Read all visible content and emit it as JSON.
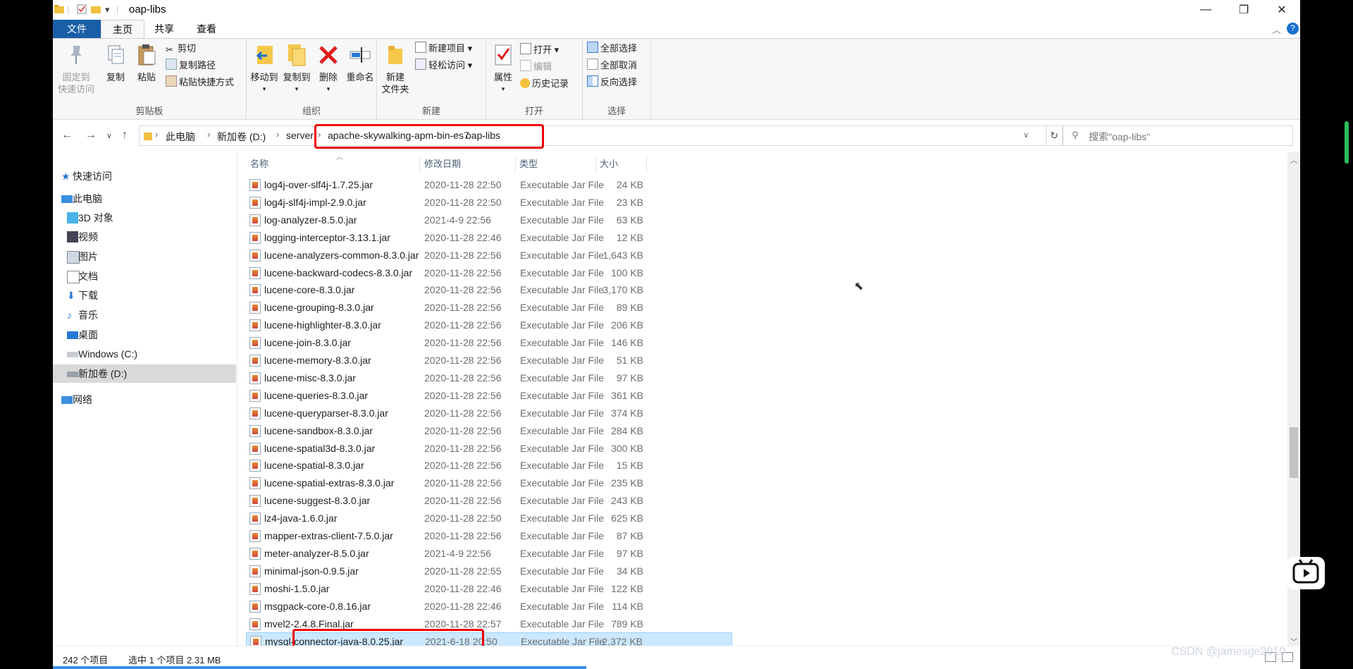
{
  "window": {
    "title": "oap-libs",
    "controls": {
      "minimize": "—",
      "maximize": "❐",
      "close": "✕"
    }
  },
  "ribbon_tabs": [
    {
      "label": "文件"
    },
    {
      "label": "主页"
    },
    {
      "label": "共享"
    },
    {
      "label": "查看"
    }
  ],
  "ribbon": {
    "clipboard": {
      "label": "剪贴板",
      "pin_line1": "固定到",
      "pin_line2": "快速访问",
      "copy": "复制",
      "paste": "粘贴",
      "cut": "剪切",
      "copy_path": "复制路径",
      "paste_shortcut": "粘贴快捷方式"
    },
    "organize": {
      "label": "组织",
      "move_to": "移动到",
      "copy_to": "复制到",
      "delete": "删除",
      "rename": "重命名"
    },
    "new": {
      "label": "新建",
      "new_folder_line1": "新建",
      "new_folder_line2": "文件夹",
      "new_item": "新建项目",
      "easy_access": "轻松访问"
    },
    "open": {
      "label": "打开",
      "properties": "属性",
      "open": "打开",
      "edit": "编辑",
      "history": "历史记录"
    },
    "select": {
      "label": "选择",
      "select_all": "全部选择",
      "select_none": "全部取消",
      "invert": "反向选择"
    }
  },
  "address": {
    "crumbs": [
      "此电脑",
      "新加卷 (D:)",
      "server",
      "apache-skywalking-apm-bin-es7",
      "oap-libs"
    ],
    "search_placeholder": "搜索\"oap-libs\""
  },
  "nav": [
    {
      "label": "快速访问"
    },
    {
      "label": "此电脑"
    },
    {
      "label": "3D 对象"
    },
    {
      "label": "视频"
    },
    {
      "label": "图片"
    },
    {
      "label": "文档"
    },
    {
      "label": "下载"
    },
    {
      "label": "音乐"
    },
    {
      "label": "桌面"
    },
    {
      "label": "Windows (C:)"
    },
    {
      "label": "新加卷 (D:)"
    },
    {
      "label": "网络"
    }
  ],
  "columns": {
    "name": "名称",
    "date": "修改日期",
    "type": "类型",
    "size": "大小"
  },
  "files": [
    {
      "name": "log4j-over-slf4j-1.7.25.jar",
      "date": "2020-11-28 22:50",
      "type": "Executable Jar File",
      "size": "24 KB"
    },
    {
      "name": "log4j-slf4j-impl-2.9.0.jar",
      "date": "2020-11-28 22:50",
      "type": "Executable Jar File",
      "size": "23 KB"
    },
    {
      "name": "log-analyzer-8.5.0.jar",
      "date": "2021-4-9 22:56",
      "type": "Executable Jar File",
      "size": "63 KB"
    },
    {
      "name": "logging-interceptor-3.13.1.jar",
      "date": "2020-11-28 22:46",
      "type": "Executable Jar File",
      "size": "12 KB"
    },
    {
      "name": "lucene-analyzers-common-8.3.0.jar",
      "date": "2020-11-28 22:56",
      "type": "Executable Jar File",
      "size": "1,643 KB"
    },
    {
      "name": "lucene-backward-codecs-8.3.0.jar",
      "date": "2020-11-28 22:56",
      "type": "Executable Jar File",
      "size": "100 KB"
    },
    {
      "name": "lucene-core-8.3.0.jar",
      "date": "2020-11-28 22:56",
      "type": "Executable Jar File",
      "size": "3,170 KB"
    },
    {
      "name": "lucene-grouping-8.3.0.jar",
      "date": "2020-11-28 22:56",
      "type": "Executable Jar File",
      "size": "89 KB"
    },
    {
      "name": "lucene-highlighter-8.3.0.jar",
      "date": "2020-11-28 22:56",
      "type": "Executable Jar File",
      "size": "206 KB"
    },
    {
      "name": "lucene-join-8.3.0.jar",
      "date": "2020-11-28 22:56",
      "type": "Executable Jar File",
      "size": "146 KB"
    },
    {
      "name": "lucene-memory-8.3.0.jar",
      "date": "2020-11-28 22:56",
      "type": "Executable Jar File",
      "size": "51 KB"
    },
    {
      "name": "lucene-misc-8.3.0.jar",
      "date": "2020-11-28 22:56",
      "type": "Executable Jar File",
      "size": "97 KB"
    },
    {
      "name": "lucene-queries-8.3.0.jar",
      "date": "2020-11-28 22:56",
      "type": "Executable Jar File",
      "size": "361 KB"
    },
    {
      "name": "lucene-queryparser-8.3.0.jar",
      "date": "2020-11-28 22:56",
      "type": "Executable Jar File",
      "size": "374 KB"
    },
    {
      "name": "lucene-sandbox-8.3.0.jar",
      "date": "2020-11-28 22:56",
      "type": "Executable Jar File",
      "size": "284 KB"
    },
    {
      "name": "lucene-spatial3d-8.3.0.jar",
      "date": "2020-11-28 22:56",
      "type": "Executable Jar File",
      "size": "300 KB"
    },
    {
      "name": "lucene-spatial-8.3.0.jar",
      "date": "2020-11-28 22:56",
      "type": "Executable Jar File",
      "size": "15 KB"
    },
    {
      "name": "lucene-spatial-extras-8.3.0.jar",
      "date": "2020-11-28 22:56",
      "type": "Executable Jar File",
      "size": "235 KB"
    },
    {
      "name": "lucene-suggest-8.3.0.jar",
      "date": "2020-11-28 22:56",
      "type": "Executable Jar File",
      "size": "243 KB"
    },
    {
      "name": "lz4-java-1.6.0.jar",
      "date": "2020-11-28 22:50",
      "type": "Executable Jar File",
      "size": "625 KB"
    },
    {
      "name": "mapper-extras-client-7.5.0.jar",
      "date": "2020-11-28 22:56",
      "type": "Executable Jar File",
      "size": "87 KB"
    },
    {
      "name": "meter-analyzer-8.5.0.jar",
      "date": "2021-4-9 22:56",
      "type": "Executable Jar File",
      "size": "97 KB"
    },
    {
      "name": "minimal-json-0.9.5.jar",
      "date": "2020-11-28 22:55",
      "type": "Executable Jar File",
      "size": "34 KB"
    },
    {
      "name": "moshi-1.5.0.jar",
      "date": "2020-11-28 22:46",
      "type": "Executable Jar File",
      "size": "122 KB"
    },
    {
      "name": "msgpack-core-0.8.16.jar",
      "date": "2020-11-28 22:46",
      "type": "Executable Jar File",
      "size": "114 KB"
    },
    {
      "name": "mvel2-2.4.8.Final.jar",
      "date": "2020-11-28 22:57",
      "type": "Executable Jar File",
      "size": "789 KB"
    },
    {
      "name": "mysql-connector-java-8.0.25.jar",
      "date": "2021-6-18 20:50",
      "type": "Executable Jar File",
      "size": "2,372 KB",
      "selected": true
    }
  ],
  "status": {
    "count": "242 个项目",
    "selected": "选中 1 个项目 2.31 MB"
  },
  "watermark": "CSDN @jamesge2010"
}
